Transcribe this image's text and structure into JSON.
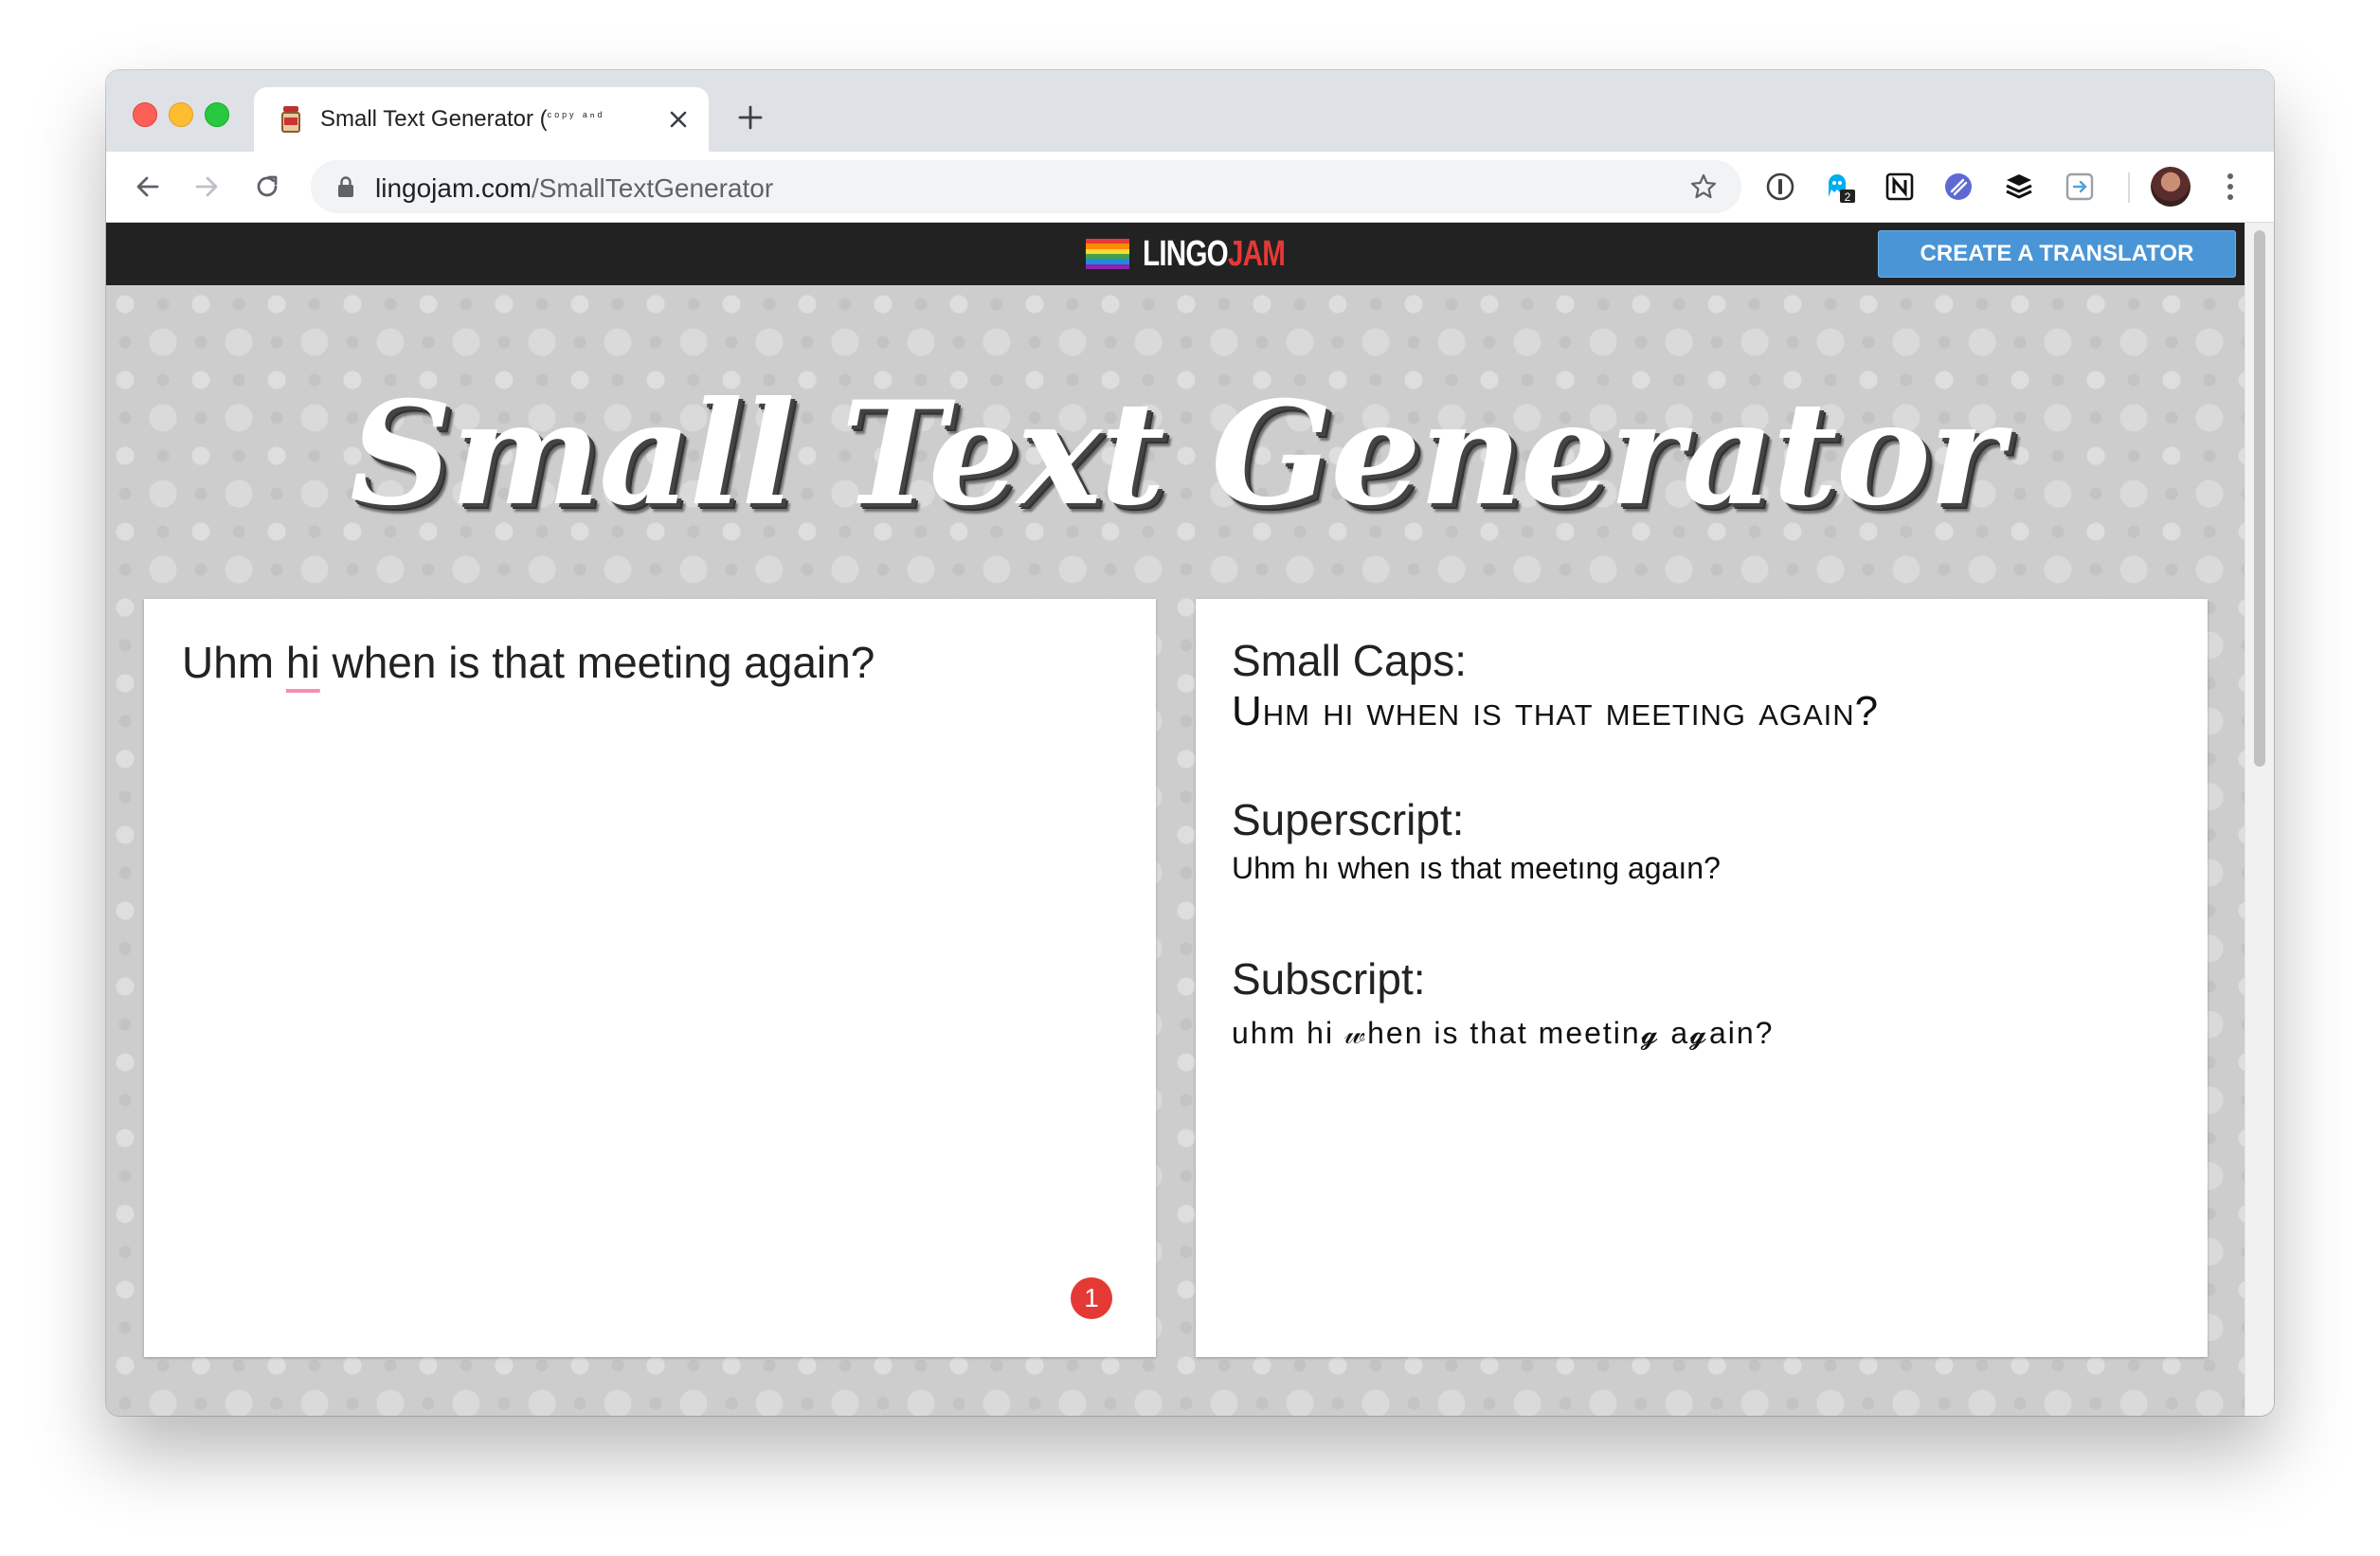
{
  "browser": {
    "tab": {
      "title": "Small Text Generator (",
      "title_suffix": "ᶜᵒᵖʸ ᵃⁿᵈ"
    },
    "url": {
      "host": "lingojam.com",
      "path": "/SmallTextGenerator"
    },
    "extensions": [
      "1password-icon",
      "ghostery-icon",
      "notion-icon",
      "linear-icon",
      "buffer-icon",
      "reader-icon"
    ],
    "extension_badge": "2"
  },
  "site": {
    "logo": {
      "part1": "LINGO",
      "part2": "JAM"
    },
    "create_button": "CREATE A TRANSLATOR",
    "hero_title": "Small Text Generator"
  },
  "input": {
    "before": "Uhm ",
    "misspelled": "hi",
    "after": " when is that meeting again?",
    "badge": "1"
  },
  "output": {
    "small_caps_label": "Small Caps:",
    "small_caps_value": "Uhm hi when is that meeting again?",
    "superscript_label": "Superscript:",
    "superscript_value": "Uhm hı when ıs that meetıng agaın?",
    "subscript_label": "Subscript:",
    "subscript_value": "uhm hi 𝓌hen is that meetin𝓰 a𝓰ain?"
  },
  "colors": {
    "topbar": "#222222",
    "create_button": "#4a95d6",
    "logo_accent": "#e53935",
    "badge": "#e53935"
  }
}
